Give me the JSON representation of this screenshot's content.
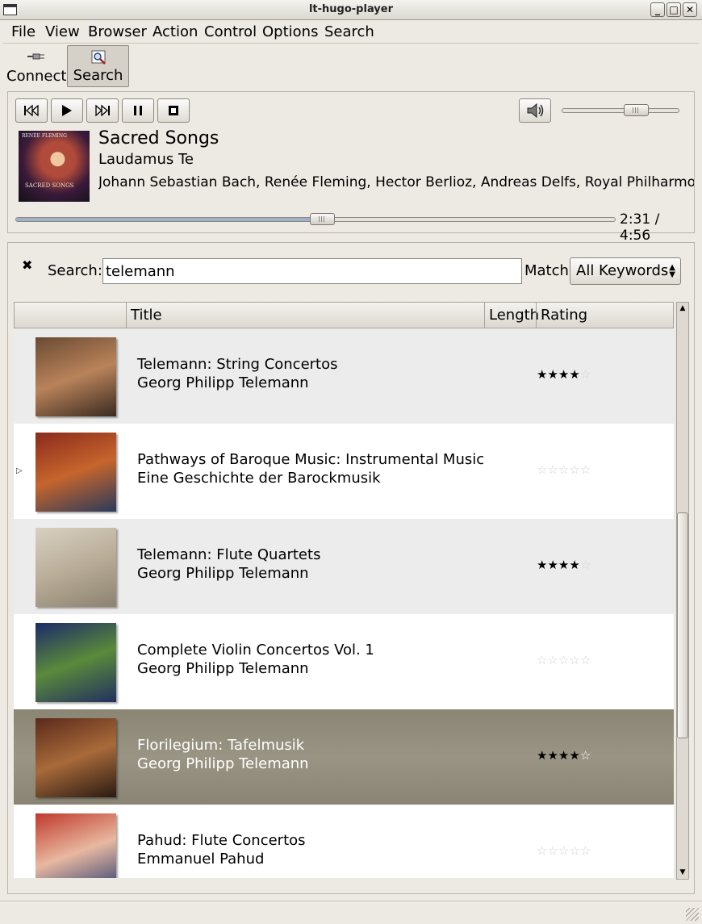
{
  "window": {
    "title": "lt-hugo-player"
  },
  "menu": [
    "File",
    "View",
    "Browser",
    "Action",
    "Control",
    "Options",
    "Search"
  ],
  "toolbar": {
    "connect_label": "Connect",
    "search_label": "Search"
  },
  "now_playing": {
    "album": "Sacred Songs",
    "track": "Laudamus Te",
    "artists": "Johann Sebastian Bach, Renée Fleming, Hector Berlioz, Andreas Delfs, Royal Philharmonic",
    "cover_text": "RENÉE FLEMING",
    "cover_subtext": "SACRED SONGS",
    "time": "2:31 / 4:56",
    "progress_fraction": 0.51,
    "volume_fraction": 0.63
  },
  "search": {
    "label": "Search:",
    "value": "telemann",
    "match_label": "Match:",
    "match_value": "All Keywords"
  },
  "table": {
    "headers": {
      "title": "Title",
      "length": "Length",
      "rating": "Rating"
    },
    "rows": [
      {
        "title": "Telemann: String Concertos",
        "artist": "Georg Philipp Telemann",
        "rating": 4,
        "art": [
          "#6a4a32",
          "#b9835a",
          "#3a2a1f"
        ]
      },
      {
        "title": "Pathways of Baroque Music: Instrumental Music",
        "artist": "Eine Geschichte der Barockmusik",
        "rating": 0,
        "art": [
          "#8a2a1c",
          "#c6652c",
          "#2a3a5a"
        ]
      },
      {
        "title": "Telemann: Flute Quartets",
        "artist": "Georg Philipp Telemann",
        "rating": 4,
        "art": [
          "#d8d0c2",
          "#b9ad98",
          "#8c8270"
        ]
      },
      {
        "title": "Complete Violin Concertos Vol. 1",
        "artist": "Georg Philipp Telemann",
        "rating": 0,
        "art": [
          "#1c2a6a",
          "#5a8a3a",
          "#223060"
        ]
      },
      {
        "title": "Florilegium: Tafelmusik",
        "artist": "Georg Philipp Telemann",
        "rating": 4,
        "art": [
          "#5a2a1a",
          "#a86a3a",
          "#2a1a12"
        ]
      },
      {
        "title": "Pahud: Flute Concertos",
        "artist": "Emmanuel Pahud",
        "rating": 0,
        "art": [
          "#c0392b",
          "#e8b8a0",
          "#2c3e70"
        ]
      }
    ]
  },
  "colors": {
    "row_alt": "#ececec",
    "row_plain": "#ffffff",
    "row_selected": "#908a7a",
    "seek_fill": "#9fb1c8"
  }
}
